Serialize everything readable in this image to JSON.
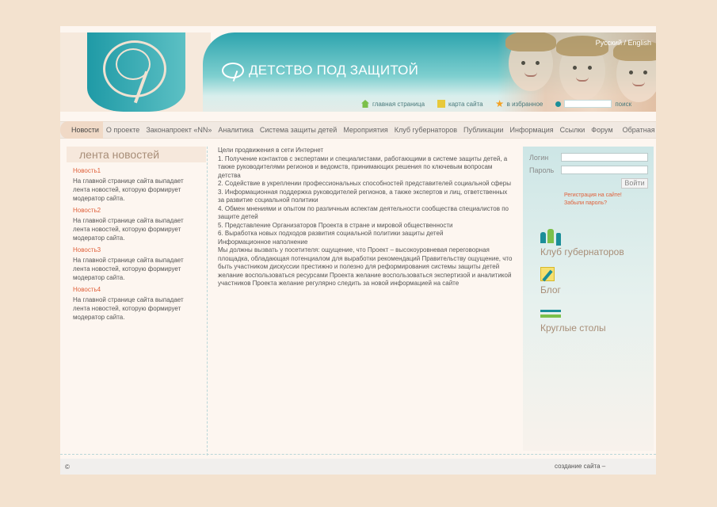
{
  "header": {
    "site_title": "ДЕТСТВО ПОД ЗАЩИТОЙ",
    "lang": "Русский / English",
    "links": {
      "home": "главная страница",
      "sitemap": "карта сайта",
      "favorites": "в избранное",
      "search": "поиск"
    }
  },
  "nav": {
    "items": [
      "Новости",
      "О проекте",
      "Законапроект «NN»",
      "Аналитика",
      "Система защиты детей",
      "Мероприятия",
      "Клуб губернаторов",
      "Публикации",
      "Информация",
      "Ссылки",
      "Форум",
      "Обратная связь"
    ]
  },
  "news": {
    "title": "лента новостей",
    "items": [
      {
        "head": "Новость1",
        "body": "На главной странице сайта выпадает лента новостей, которую формирует модератор сайта."
      },
      {
        "head": "Новость2",
        "body": "На главной странице сайта выпадает лента новостей, которую формирует модератор сайта."
      },
      {
        "head": "Новость3",
        "body": "На главной странице сайта выпадает лента новостей, которую формирует модератор сайта."
      },
      {
        "head": "Новость4",
        "body": "На главной странице сайта выпадает лента новостей, которую формирует модератор сайта."
      }
    ]
  },
  "main": {
    "lines": [
      "Цели продвижения в сети Интернет",
      "1. Получение контактов с экспертами и специалистами, работающими в системе защиты детей, а также руководителями регионов и ведомств, принимающих решения по ключевым вопросам детства",
      "2. Содействие в укреплении профессиональных способностей представителей социальной сферы",
      "3. Информационная поддержка руководителей регионов, а также экспертов и лиц, ответственных за развитие социальной политики",
      "4. Обмен мнениями и опытом по различным аспектам деятельности сообщества специалистов по защите детей",
      "5. Представление Организаторов Проекта в стране и мировой общественности",
      "6. Выработка новых подходов развития социальной политики защиты детей",
      "Информационное наполнение",
      "Мы должны вызвать у посетителя: ощущение, что Проект – высокоуровневая переговорная площадка, обладающая потенциалом для выработки рекомендаций Правительству ощущение, что быть участником дискуссии престижно и полезно для реформирования системы защиты детей желание воспользоваться ресурсами Проекта желание воспользоваться экспертизой и аналитикой участников Проекта желание регулярно следить за новой информацией на сайте"
    ]
  },
  "login": {
    "login_label": "Логин",
    "password_label": "Пароль",
    "button": "Войти",
    "register": "Регистрация на сайте!",
    "forgot": "Забыли пароль?"
  },
  "features": {
    "club": "Клуб губернаторов",
    "blog": "Блог",
    "round": "Круглые столы"
  },
  "footer": {
    "copyright": "©",
    "made": "создание сайта –"
  },
  "colors": {
    "accent_teal": "#1b8e98",
    "news_head": "#e0603a",
    "background": "#f3e2cf"
  }
}
